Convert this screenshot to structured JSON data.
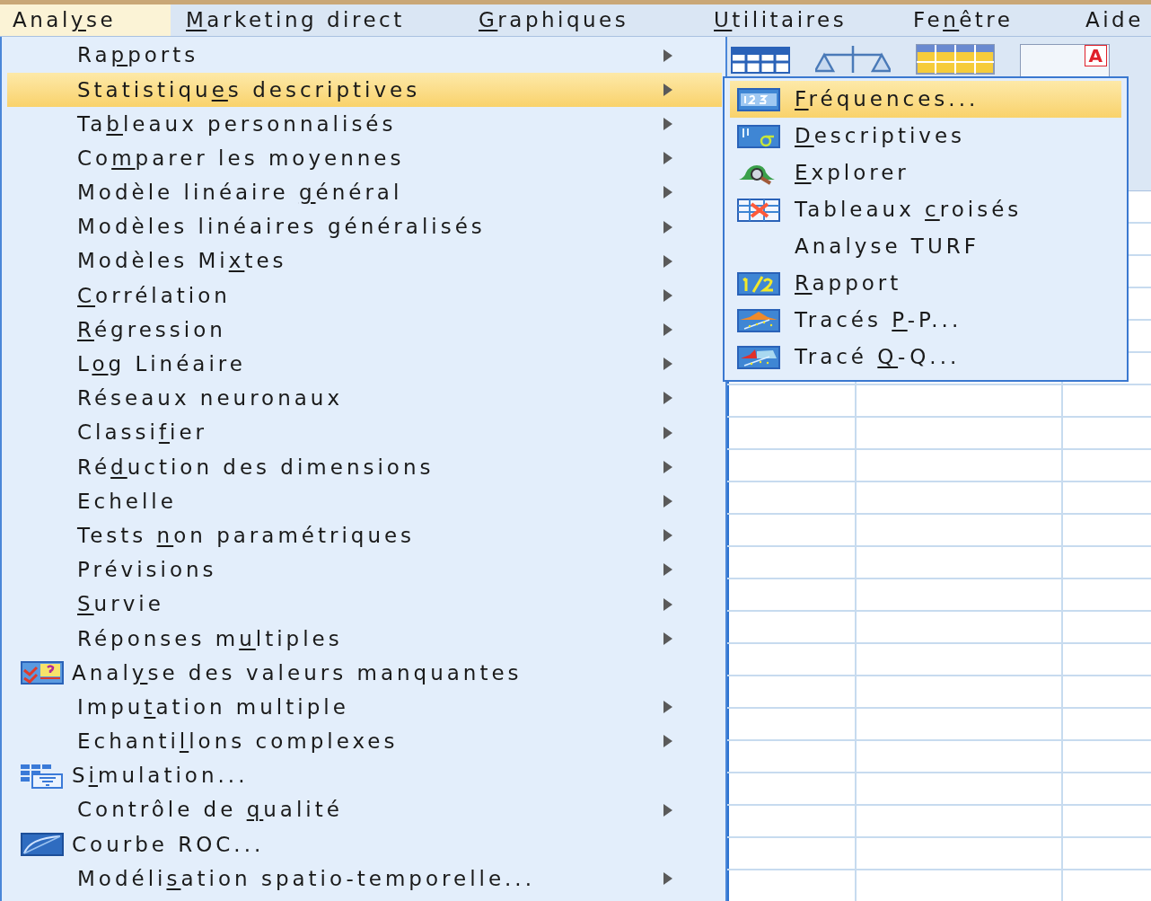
{
  "menu_bar": [
    {
      "label": {
        "before": "Anal",
        "key": "y",
        "after": "se"
      },
      "selected": true
    },
    {
      "label": {
        "key": "M",
        "after": "arketing direct"
      },
      "selected": false
    },
    {
      "label": {
        "key": "G",
        "after": "raphiques"
      },
      "selected": false
    },
    {
      "label": {
        "key": "U",
        "after": "tilitaires"
      },
      "selected": false
    },
    {
      "label": {
        "before": "Fe",
        "key": "n",
        "after": "être"
      },
      "selected": false
    },
    {
      "label": {
        "before": "Aide"
      },
      "selected": false
    }
  ],
  "toolbar": {
    "badge": "A"
  },
  "menu": [
    {
      "label": {
        "before": "Ra",
        "key": "p",
        "after": "ports"
      },
      "submenu": true,
      "selected": false
    },
    {
      "label": {
        "before": "Statistiqu",
        "key": "e",
        "after": "s descriptives"
      },
      "submenu": true,
      "selected": true
    },
    {
      "label": {
        "before": "Ta",
        "key": "b",
        "after": "leaux personnalisés"
      },
      "submenu": true,
      "selected": false
    },
    {
      "label": {
        "before": "Co",
        "key": "m",
        "after": "parer les moyennes"
      },
      "submenu": true,
      "selected": false
    },
    {
      "label": {
        "before": "Modèle linéaire ",
        "key": "g",
        "after": "énéral"
      },
      "submenu": true,
      "selected": false
    },
    {
      "label": {
        "before": "Modèles linéaires généralisés"
      },
      "submenu": true,
      "selected": false
    },
    {
      "label": {
        "before": "Modèles Mi",
        "key": "x",
        "after": "tes"
      },
      "submenu": true,
      "selected": false
    },
    {
      "label": {
        "key": "C",
        "after": "orrélation"
      },
      "submenu": true,
      "selected": false
    },
    {
      "label": {
        "key": "R",
        "after": "égression"
      },
      "submenu": true,
      "selected": false
    },
    {
      "label": {
        "before": "L",
        "key": "o",
        "after": "g Linéaire"
      },
      "submenu": true,
      "selected": false
    },
    {
      "label": {
        "before": "Réseaux neuronaux"
      },
      "submenu": true,
      "selected": false
    },
    {
      "label": {
        "before": "Classi",
        "key": "f",
        "after": "ier"
      },
      "submenu": true,
      "selected": false
    },
    {
      "label": {
        "before": "Ré",
        "key": "d",
        "after": "uction des dimensions"
      },
      "submenu": true,
      "selected": false
    },
    {
      "label": {
        "before": "Echelle"
      },
      "submenu": true,
      "selected": false
    },
    {
      "label": {
        "before": "Tests ",
        "key": "n",
        "after": "on paramétriques"
      },
      "submenu": true,
      "selected": false
    },
    {
      "label": {
        "before": "Prévisions"
      },
      "submenu": true,
      "selected": false
    },
    {
      "label": {
        "key": "S",
        "after": "urvie"
      },
      "submenu": true,
      "selected": false
    },
    {
      "label": {
        "before": "Réponses m",
        "key": "u",
        "after": "ltiples"
      },
      "submenu": true,
      "selected": false
    },
    {
      "label": {
        "before": "Anal",
        "key": "y",
        "after": "se des valeurs manquantes"
      },
      "kind": "missing",
      "submenu": false,
      "selected": false
    },
    {
      "label": {
        "before": "Impu",
        "key": "t",
        "after": "ation multiple"
      },
      "submenu": true,
      "selected": false
    },
    {
      "label": {
        "before": "Echanti",
        "key": "l",
        "after": "lons complexes"
      },
      "submenu": true,
      "selected": false
    },
    {
      "label": {
        "before": "S",
        "key": "i",
        "after": "mulation..."
      },
      "kind": "simulation",
      "submenu": false,
      "selected": false
    },
    {
      "label": {
        "before": "Contrôle de ",
        "key": "q",
        "after": "ualité"
      },
      "submenu": true,
      "selected": false
    },
    {
      "label": {
        "before": "Courbe ROC..."
      },
      "kind": "roc",
      "submenu": false,
      "selected": false
    },
    {
      "label": {
        "before": "Modéli",
        "key": "s",
        "after": "ation spatio-temporelle..."
      },
      "submenu": true,
      "selected": false
    }
  ],
  "submenu": [
    {
      "label": {
        "key": "F",
        "after": "réquences..."
      },
      "kind": "frequencies",
      "selected": true
    },
    {
      "label": {
        "key": "D",
        "after": "escriptives"
      },
      "kind": "descriptives",
      "selected": false
    },
    {
      "label": {
        "key": "E",
        "after": "xplorer"
      },
      "kind": "explore",
      "selected": false
    },
    {
      "label": {
        "before": "Tableaux ",
        "key": "c",
        "after": "roisés"
      },
      "kind": "crosstabs",
      "selected": false
    },
    {
      "label": {
        "before": "Analyse TURF"
      },
      "selected": false
    },
    {
      "label": {
        "key": "R",
        "after": "apport"
      },
      "kind": "ratio",
      "selected": false
    },
    {
      "label": {
        "before": "Tracés ",
        "key": "P",
        "after": "-P..."
      },
      "kind": "pp",
      "selected": false
    },
    {
      "label": {
        "before": "Tracé ",
        "key": "Q",
        "after": "-Q..."
      },
      "kind": "qq",
      "selected": false
    }
  ]
}
